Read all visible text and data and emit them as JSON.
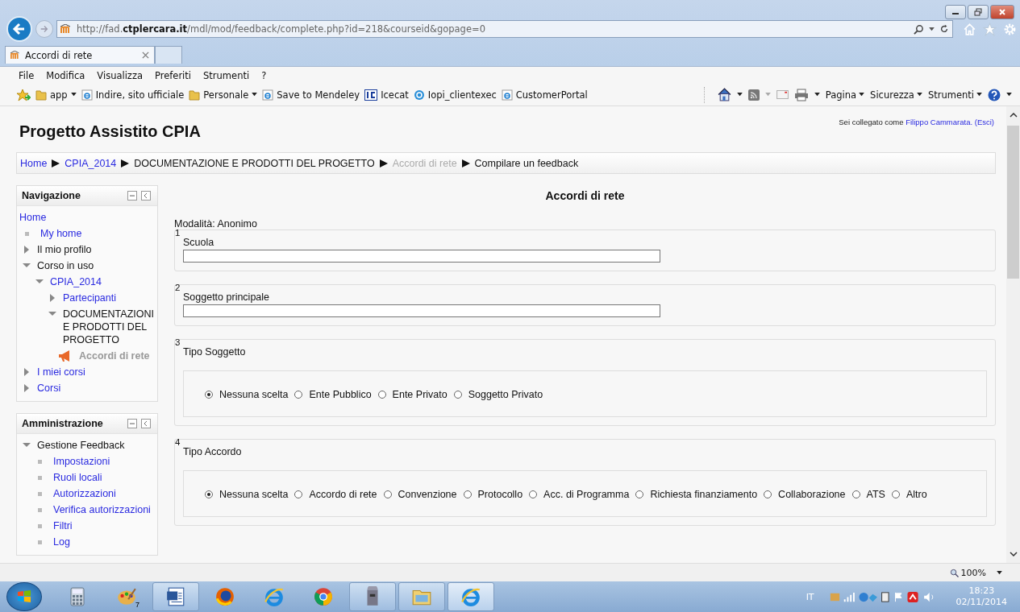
{
  "browser": {
    "address": "http://fad.**ctplercara.it**/mdl/mod/feedback/complete.php?id=218&courseid&gopage=0",
    "tab_title": "Accordi di rete",
    "menu": [
      "File",
      "Modifica",
      "Visualizza",
      "Preferiti",
      "Strumenti",
      "?"
    ],
    "favorites": [
      {
        "kind": "folder",
        "label": "app"
      },
      {
        "kind": "page",
        "label": "Indire, sito ufficiale"
      },
      {
        "kind": "folder",
        "label": "Personale"
      },
      {
        "kind": "page",
        "label": "Save to Mendeley"
      },
      {
        "kind": "ic",
        "label": "Icecat"
      },
      {
        "kind": "globe",
        "label": "Iopi_clientexec"
      },
      {
        "kind": "page",
        "label": "CustomerPortal"
      }
    ],
    "commands": [
      "Pagina",
      "Sicurezza",
      "Strumenti"
    ]
  },
  "page": {
    "site_title": "Progetto Assistito CPIA",
    "login": {
      "text": "Sei collegato come",
      "user": "Filippo Cammarata.",
      "logout": "(Esci)"
    },
    "breadcrumb": [
      {
        "label": "Home",
        "kind": "link"
      },
      {
        "label": "CPIA_2014",
        "kind": "link"
      },
      {
        "label": "DOCUMENTAZIONE E PRODOTTI DEL PROGETTO",
        "kind": "text"
      },
      {
        "label": "Accordi di rete",
        "kind": "dimmed"
      },
      {
        "label": "Compilare un feedback",
        "kind": "text"
      }
    ],
    "blocks": [
      {
        "title": "Navigazione",
        "root": "Home",
        "items": [
          {
            "label": "My home",
            "kind": "leaf",
            "link": true
          },
          {
            "label": "Il mio profilo",
            "kind": "branch",
            "link": false,
            "expanded": false
          },
          {
            "label": "Corso in uso",
            "kind": "branch",
            "link": false,
            "expanded": true,
            "children": [
              {
                "label": "CPIA_2014",
                "kind": "branch",
                "link": true,
                "expanded": true,
                "children": [
                  {
                    "label": "Partecipanti",
                    "kind": "branch",
                    "link": true,
                    "expanded": false
                  },
                  {
                    "label": "DOCUMENTAZIONI E PRODOTTI DEL PROGETTO",
                    "kind": "branch",
                    "link": false,
                    "expanded": true,
                    "children": [
                      {
                        "label": "Accordi di rete",
                        "kind": "activity",
                        "link": false
                      }
                    ]
                  }
                ]
              }
            ]
          },
          {
            "label": "I miei corsi",
            "kind": "branch",
            "link": true,
            "expanded": false
          },
          {
            "label": "Corsi",
            "kind": "branch",
            "link": true,
            "expanded": false
          }
        ]
      },
      {
        "title": "Amministrazione",
        "items": [
          {
            "label": "Gestione Feedback",
            "kind": "branch",
            "link": false,
            "expanded": true,
            "children": [
              {
                "label": "Impostazioni",
                "kind": "leaf",
                "link": true
              },
              {
                "label": "Ruoli locali",
                "kind": "leaf",
                "link": true
              },
              {
                "label": "Autorizzazioni",
                "kind": "leaf",
                "link": true
              },
              {
                "label": "Verifica autorizzazioni",
                "kind": "leaf",
                "link": true
              },
              {
                "label": "Filtri",
                "kind": "leaf",
                "link": true
              },
              {
                "label": "Log",
                "kind": "leaf",
                "link": true
              }
            ]
          }
        ]
      }
    ],
    "form": {
      "heading": "Accordi di rete",
      "mode": "Modalità: Anonimo",
      "questions": [
        {
          "number": "1",
          "label": "Scuola",
          "kind": "text"
        },
        {
          "number": "2",
          "label": "Soggetto principale",
          "kind": "text"
        },
        {
          "number": "3",
          "label": "Tipo Soggetto",
          "kind": "radio",
          "options": [
            {
              "label": "Nessuna scelta",
              "selected": true
            },
            {
              "label": "Ente Pubblico",
              "selected": false
            },
            {
              "label": "Ente Privato",
              "selected": false
            },
            {
              "label": "Soggetto Privato",
              "selected": false
            }
          ]
        },
        {
          "number": "4",
          "label": "Tipo Accordo",
          "kind": "radio",
          "options": [
            {
              "label": "Nessuna scelta",
              "selected": true
            },
            {
              "label": "Accordo di rete",
              "selected": false
            },
            {
              "label": "Convenzione",
              "selected": false
            },
            {
              "label": "Protocollo",
              "selected": false
            },
            {
              "label": "Acc. di Programma",
              "selected": false
            },
            {
              "label": "Richiesta finanziamento",
              "selected": false
            },
            {
              "label": "Collaborazione",
              "selected": false
            },
            {
              "label": "ATS",
              "selected": false
            },
            {
              "label": "Altro",
              "selected": false
            }
          ]
        }
      ]
    }
  },
  "status_bar": {
    "zoom": "100%"
  },
  "taskbar": {
    "apps": [
      {
        "kind": "calculator",
        "open": false,
        "selected": false
      },
      {
        "kind": "paint",
        "open": false,
        "selected": false,
        "badge": "7"
      },
      {
        "kind": "word",
        "open": true,
        "selected": false
      },
      {
        "kind": "firefox",
        "open": false,
        "selected": false
      },
      {
        "kind": "ie",
        "open": false,
        "selected": false
      },
      {
        "kind": "chrome",
        "open": false,
        "selected": false
      },
      {
        "kind": "mailbox",
        "open": true,
        "selected": false
      },
      {
        "kind": "explorer",
        "open": true,
        "selected": false
      },
      {
        "kind": "ie",
        "open": true,
        "selected": true
      }
    ],
    "language": "IT",
    "time": "18:23",
    "date": "02/11/2014"
  }
}
